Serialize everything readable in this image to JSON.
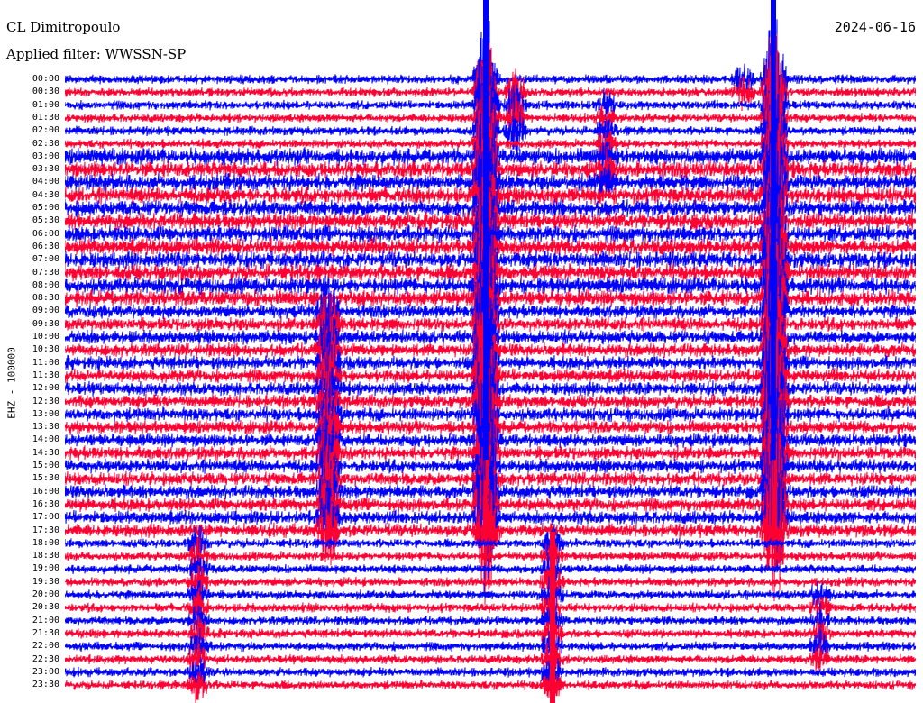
{
  "header": {
    "station": "CL Dimitropoulo",
    "filter": "Applied filter: WWSSN-SP",
    "date": "2024-06-16"
  },
  "axis": {
    "channel_label": "EHZ - 100000",
    "hour_labels": [
      "00:00",
      "00:30",
      "01:00",
      "01:30",
      "02:00",
      "02:30",
      "03:00",
      "03:30",
      "04:00",
      "04:30",
      "05:00",
      "05:30",
      "06:00",
      "06:30",
      "07:00",
      "07:30",
      "08:00",
      "08:30",
      "09:00",
      "09:30",
      "10:00",
      "10:30",
      "11:00",
      "11:30",
      "12:00",
      "12:30",
      "13:00",
      "13:30",
      "14:00",
      "14:30",
      "15:00",
      "15:30",
      "16:00",
      "16:30",
      "17:00",
      "17:30",
      "18:00",
      "18:30",
      "19:00",
      "19:30",
      "20:00",
      "20:30",
      "21:00",
      "21:30",
      "22:00",
      "22:30",
      "23:00",
      "23:30"
    ]
  },
  "colors": {
    "trace_even": "#0000ff",
    "trace_odd": "#ff0033",
    "background": "#ffffff"
  }
}
